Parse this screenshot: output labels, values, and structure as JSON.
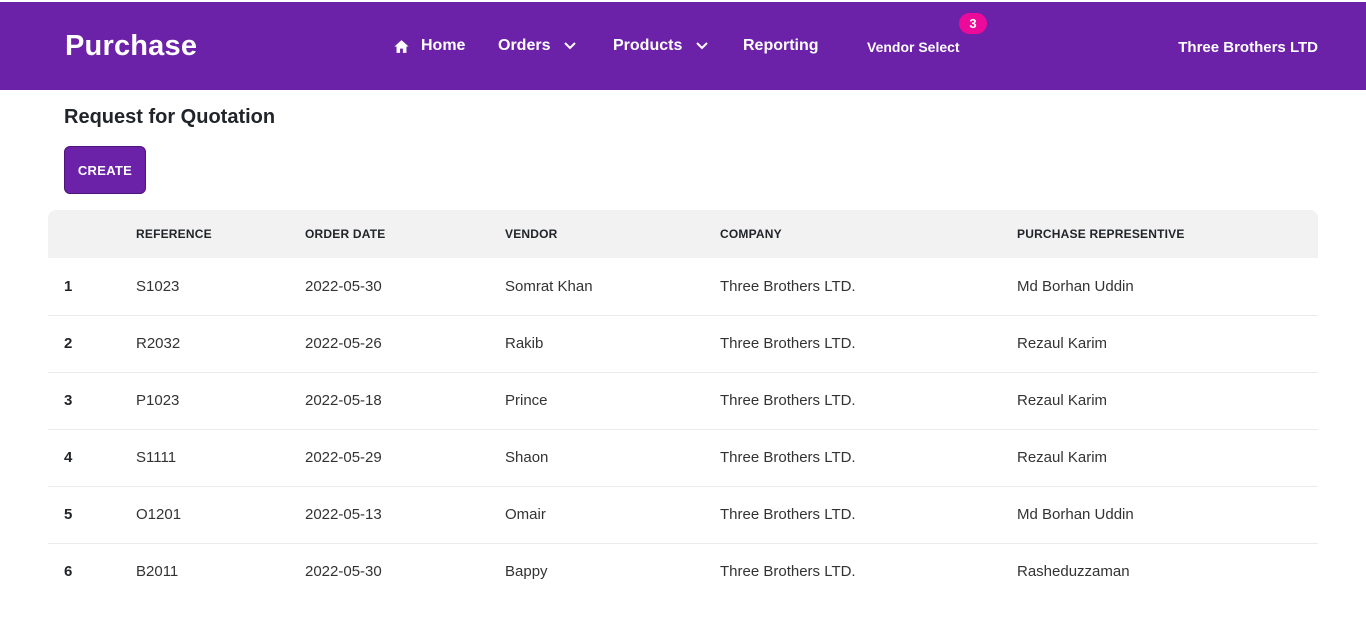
{
  "navbar": {
    "brand": "Purchase",
    "home": "Home",
    "orders": "Orders",
    "products": "Products",
    "reporting": "Reporting",
    "vendor_select": "Vendor Select",
    "vendor_badge": "3",
    "company": "Three Brothers LTD"
  },
  "page": {
    "title": "Request for Quotation",
    "create_label": "CREATE"
  },
  "table": {
    "headers": [
      "",
      "REFERENCE",
      "ORDER DATE",
      "VENDOR",
      "COMPANY",
      "PURCHASE REPRESENTIVE"
    ],
    "rows": [
      [
        "1",
        "S1023",
        "2022-05-30",
        "Somrat Khan",
        "Three Brothers LTD.",
        "Md Borhan Uddin"
      ],
      [
        "2",
        "R2032",
        "2022-05-26",
        "Rakib",
        "Three Brothers LTD.",
        "Rezaul Karim"
      ],
      [
        "3",
        "P1023",
        "2022-05-18",
        "Prince",
        "Three Brothers LTD.",
        "Rezaul Karim"
      ],
      [
        "4",
        "S1111",
        "2022-05-29",
        "Shaon",
        "Three Brothers LTD.",
        "Rezaul Karim"
      ],
      [
        "5",
        "O1201",
        "2022-05-13",
        "Omair",
        "Three Brothers LTD.",
        "Md Borhan Uddin"
      ],
      [
        "6",
        "B2011",
        "2022-05-30",
        "Bappy",
        "Three Brothers LTD.",
        "Rasheduzzaman"
      ]
    ]
  },
  "colors": {
    "brand_purple": "#6b21a8",
    "badge_pink": "#ec0a9a",
    "header_row": "#f2f2f2"
  },
  "icons": {
    "home": "home-icon",
    "orders_dropdown": "chevron-down-icon",
    "products_dropdown": "chevron-down-icon"
  }
}
